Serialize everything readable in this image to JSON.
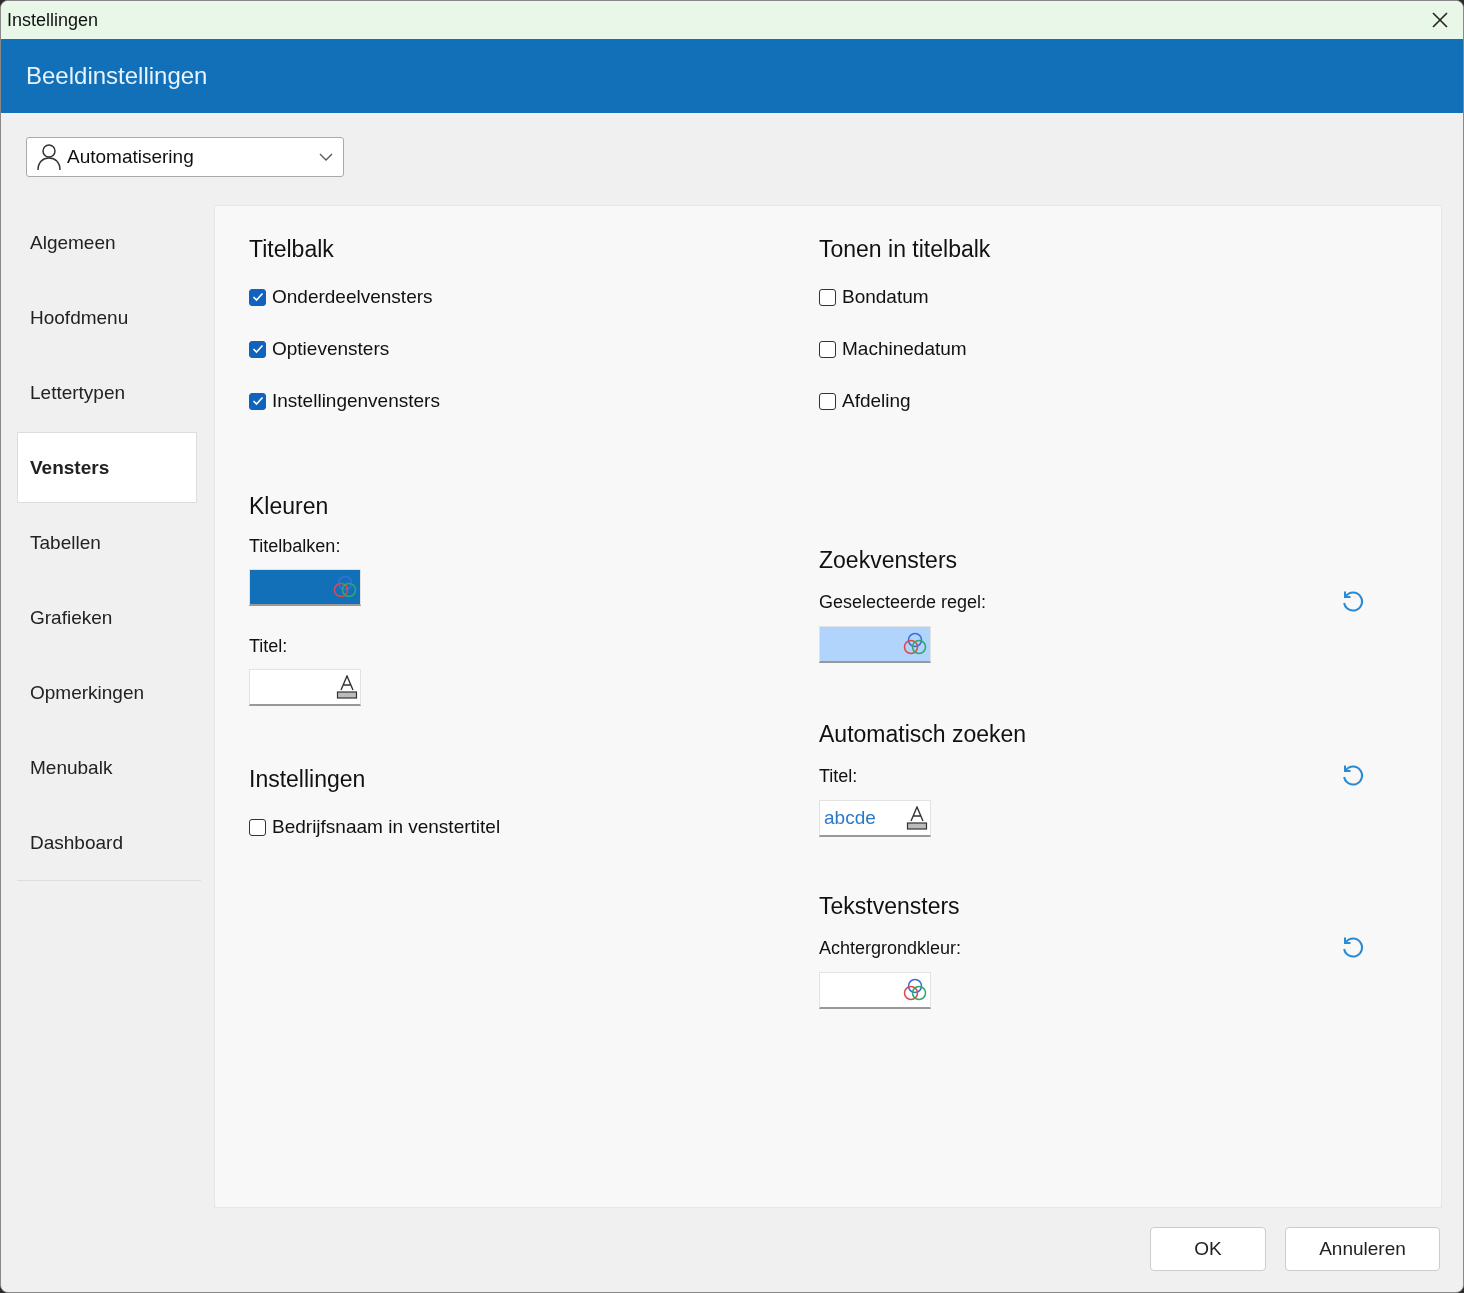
{
  "window": {
    "title": "Instellingen"
  },
  "header": {
    "title": "Beeldinstellingen"
  },
  "profile_dropdown": {
    "value": "Automatisering"
  },
  "sidebar": {
    "items": [
      {
        "label": "Algemeen",
        "selected": false
      },
      {
        "label": "Hoofdmenu",
        "selected": false
      },
      {
        "label": "Lettertypen",
        "selected": false
      },
      {
        "label": "Vensters",
        "selected": true
      },
      {
        "label": "Tabellen",
        "selected": false
      },
      {
        "label": "Grafieken",
        "selected": false
      },
      {
        "label": "Opmerkingen",
        "selected": false
      },
      {
        "label": "Menubalk",
        "selected": false
      },
      {
        "label": "Dashboard",
        "selected": false
      }
    ]
  },
  "left_column": [
    {
      "heading": "Titelbalk",
      "items": [
        {
          "kind": "checkbox",
          "label": "Onderdeelvensters",
          "checked": true
        },
        {
          "kind": "checkbox",
          "label": "Optievensters",
          "checked": true
        },
        {
          "kind": "checkbox",
          "label": "Instellingenvensters",
          "checked": true
        }
      ]
    },
    {
      "heading": "Kleuren",
      "items": [
        {
          "kind": "color",
          "label": "Titelbalken:",
          "color": "#1270b8",
          "reset": false
        },
        {
          "kind": "font",
          "label": "Titel:",
          "reset": false
        }
      ]
    },
    {
      "heading": "Instellingen",
      "items": [
        {
          "kind": "checkbox",
          "label": "Bedrijfsnaam in venstertitel",
          "checked": false
        }
      ]
    }
  ],
  "right_column": [
    {
      "heading": "Tonen in titelbalk",
      "items": [
        {
          "kind": "checkbox",
          "label": "Bondatum",
          "checked": false
        },
        {
          "kind": "checkbox",
          "label": "Machinedatum",
          "checked": false
        },
        {
          "kind": "checkbox",
          "label": "Afdeling",
          "checked": false
        }
      ]
    },
    {
      "heading": "Zoekvensters",
      "items": [
        {
          "kind": "color",
          "label": "Geselecteerde regel:",
          "color": "#b0d4fc",
          "reset": true
        }
      ]
    },
    {
      "heading": "Automatisch zoeken",
      "items": [
        {
          "kind": "font",
          "label": "Titel:",
          "sample": "abcde",
          "reset": true
        }
      ]
    },
    {
      "heading": "Tekstvensters",
      "items": [
        {
          "kind": "color",
          "label": "Achtergrondkleur:",
          "color": "#ffffff",
          "reset": true
        }
      ]
    }
  ],
  "buttons": [
    "OK",
    "Annuleren"
  ]
}
